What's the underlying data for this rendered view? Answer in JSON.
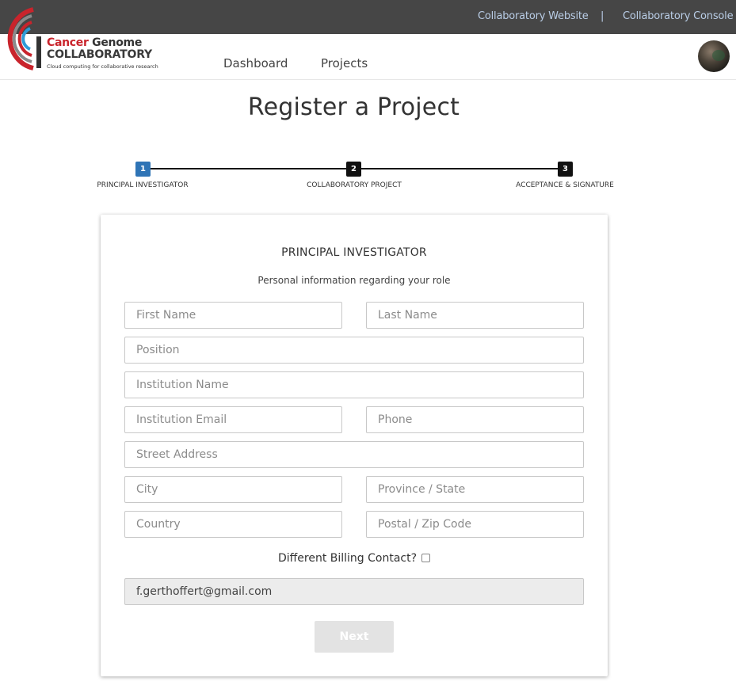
{
  "topbar": {
    "website_link": "Collaboratory Website",
    "separator": "|",
    "console_link": "Collaboratory Console"
  },
  "logo": {
    "line1_red": "Cancer",
    "line1_rest": " Genome",
    "line2": "COLLABORATORY",
    "tagline": "Cloud computing for collaborative research"
  },
  "nav": {
    "dashboard": "Dashboard",
    "projects": "Projects"
  },
  "page": {
    "title": "Register a Project"
  },
  "stepper": {
    "steps": [
      {
        "number": "1",
        "label": "PRINCIPAL INVESTIGATOR",
        "state": "active"
      },
      {
        "number": "2",
        "label": "COLLABORATORY PROJECT",
        "state": "inactive"
      },
      {
        "number": "3",
        "label": "ACCEPTANCE & SIGNATURE",
        "state": "inactive"
      }
    ]
  },
  "form": {
    "title": "PRINCIPAL INVESTIGATOR",
    "subtitle": "Personal information regarding your role",
    "first_name_placeholder": "First Name",
    "last_name_placeholder": "Last Name",
    "position_placeholder": "Position",
    "institution_name_placeholder": "Institution Name",
    "institution_email_placeholder": "Institution Email",
    "phone_placeholder": "Phone",
    "street_placeholder": "Street Address",
    "city_placeholder": "City",
    "province_placeholder": "Province / State",
    "country_placeholder": "Country",
    "postal_placeholder": "Postal / Zip Code",
    "billing_label": "Different Billing Contact?",
    "billing_checked": false,
    "email_value": "f.gerthoffert@gmail.com",
    "next_label": "Next"
  },
  "colors": {
    "topbar_bg": "#464646",
    "topbar_link": "#b9cde6",
    "brand_red": "#c9242c",
    "brand_blue": "#2f9bd6",
    "step_active": "#2f74b6",
    "button_disabled": "#e3e3e3"
  }
}
